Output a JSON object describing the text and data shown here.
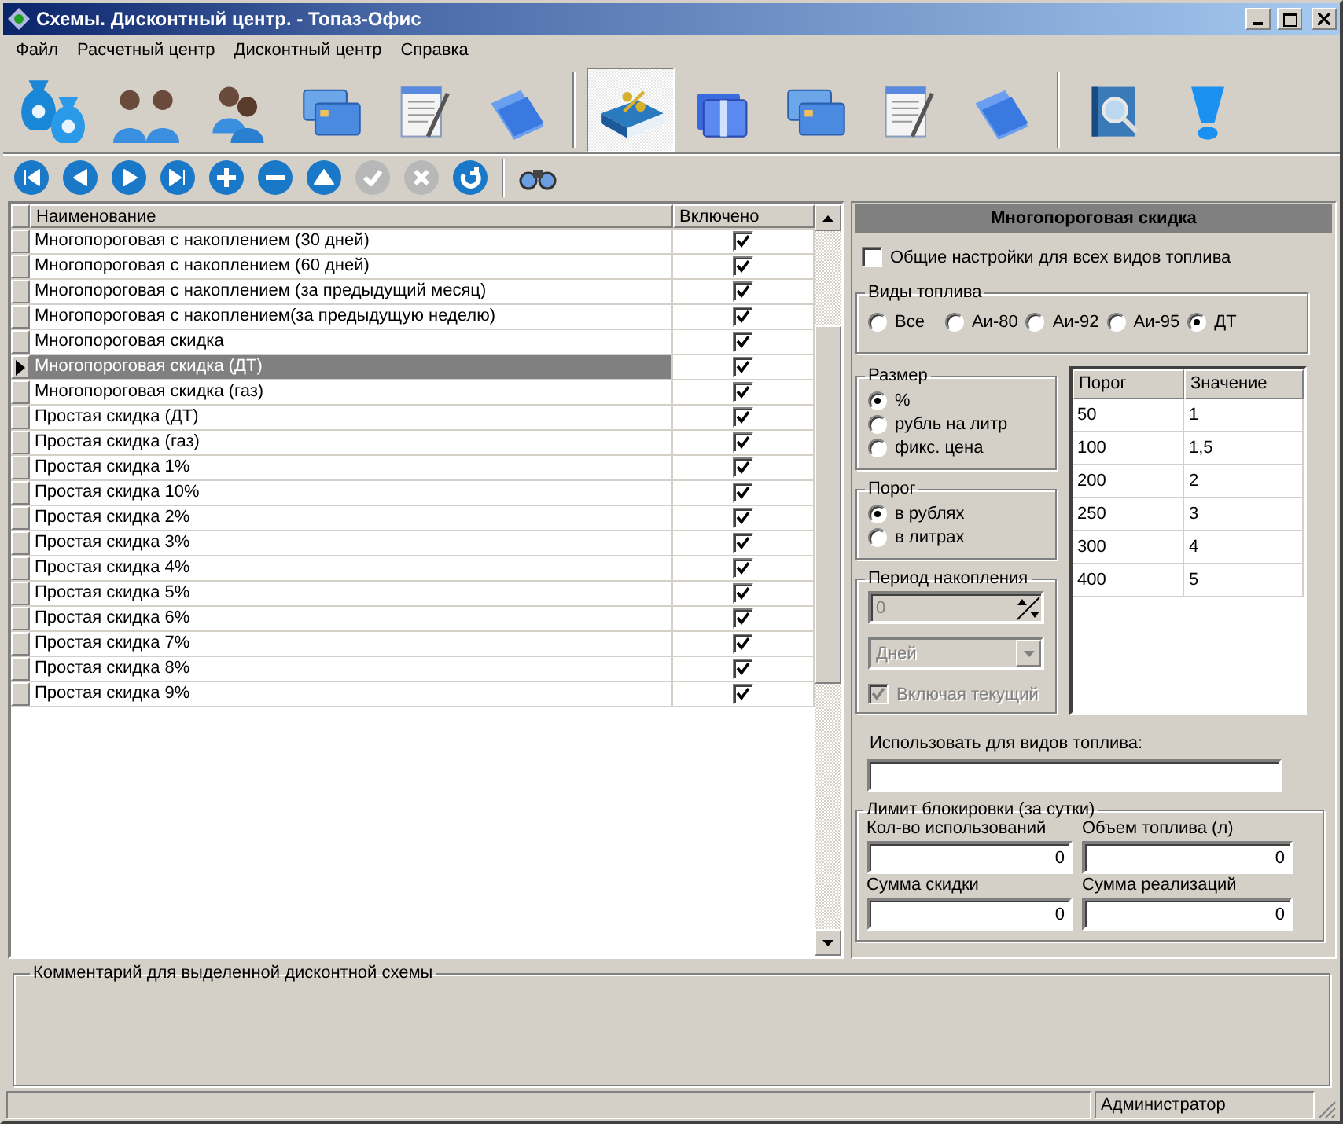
{
  "window": {
    "title": "Схемы. Дисконтный центр. - Топаз-Офис"
  },
  "menu": [
    "Файл",
    "Расчетный центр",
    "Дисконтный центр",
    "Справка"
  ],
  "toolbar": [
    {
      "kind": "bags",
      "selected": false
    },
    {
      "kind": "people",
      "selected": false
    },
    {
      "kind": "pair",
      "selected": false
    },
    {
      "kind": "cards",
      "selected": false
    },
    {
      "kind": "notepad",
      "selected": false
    },
    {
      "kind": "folder",
      "selected": false
    },
    {
      "kind": "separator"
    },
    {
      "kind": "book",
      "selected": true
    },
    {
      "kind": "stack",
      "selected": false
    },
    {
      "kind": "cards",
      "selected": false
    },
    {
      "kind": "notepad",
      "selected": false
    },
    {
      "kind": "folder",
      "selected": false
    },
    {
      "kind": "separator"
    },
    {
      "kind": "search",
      "selected": false
    },
    {
      "kind": "alert",
      "selected": false
    }
  ],
  "navigator": [
    {
      "kind": "first",
      "disabled": false
    },
    {
      "kind": "prev",
      "disabled": false
    },
    {
      "kind": "next",
      "disabled": false
    },
    {
      "kind": "last",
      "disabled": false
    },
    {
      "kind": "add",
      "disabled": false
    },
    {
      "kind": "remove",
      "disabled": false
    },
    {
      "kind": "up",
      "disabled": false
    },
    {
      "kind": "post",
      "disabled": true
    },
    {
      "kind": "cancel",
      "disabled": true
    },
    {
      "kind": "refresh",
      "disabled": false
    },
    {
      "kind": "separator"
    },
    {
      "kind": "find",
      "disabled": false
    }
  ],
  "grid": {
    "columns": [
      "Наименование",
      "Включено"
    ],
    "rows": [
      {
        "name": "Многопороговая с накоплением (30 дней)",
        "enabled": true,
        "selected": false
      },
      {
        "name": "Многопороговая с накоплением (60 дней)",
        "enabled": true,
        "selected": false
      },
      {
        "name": "Многопороговая с накоплением (за предыдущий месяц)",
        "enabled": true,
        "selected": false
      },
      {
        "name": "Многопороговая с накоплением(за предыдущую неделю)",
        "enabled": true,
        "selected": false
      },
      {
        "name": "Многопороговая скидка",
        "enabled": true,
        "selected": false
      },
      {
        "name": "Многопороговая скидка (ДТ)",
        "enabled": true,
        "selected": true
      },
      {
        "name": "Многопороговая скидка (газ)",
        "enabled": true,
        "selected": false
      },
      {
        "name": "Простая скидка (ДТ)",
        "enabled": true,
        "selected": false
      },
      {
        "name": "Простая скидка (газ)",
        "enabled": true,
        "selected": false
      },
      {
        "name": "Простая скидка 1%",
        "enabled": true,
        "selected": false
      },
      {
        "name": "Простая скидка 10%",
        "enabled": true,
        "selected": false
      },
      {
        "name": "Простая скидка 2%",
        "enabled": true,
        "selected": false
      },
      {
        "name": "Простая скидка 3%",
        "enabled": true,
        "selected": false
      },
      {
        "name": "Простая скидка 4%",
        "enabled": true,
        "selected": false
      },
      {
        "name": "Простая скидка 5%",
        "enabled": true,
        "selected": false
      },
      {
        "name": "Простая скидка 6%",
        "enabled": true,
        "selected": false
      },
      {
        "name": "Простая скидка 7%",
        "enabled": true,
        "selected": false
      },
      {
        "name": "Простая скидка 8%",
        "enabled": true,
        "selected": false
      },
      {
        "name": "Простая скидка 9%",
        "enabled": true,
        "selected": false
      }
    ]
  },
  "panel": {
    "title": "Многопороговая скидка",
    "common": {
      "label": "Общие настройки для всех видов топлива",
      "checked": false
    },
    "fuel": {
      "label": "Виды топлива",
      "options": [
        {
          "label": "Все",
          "selected": false
        },
        {
          "label": "Аи-80",
          "selected": false
        },
        {
          "label": "Аи-92",
          "selected": false
        },
        {
          "label": "Аи-95",
          "selected": false
        },
        {
          "label": "ДТ",
          "selected": true
        }
      ]
    },
    "size": {
      "label": "Размер",
      "options": [
        {
          "label": "%",
          "selected": true
        },
        {
          "label": "рубль на литр",
          "selected": false
        },
        {
          "label": "фикс. цена",
          "selected": false
        }
      ]
    },
    "threshold": {
      "label": "Порог",
      "options": [
        {
          "label": "в рублях",
          "selected": true
        },
        {
          "label": "в литрах",
          "selected": false
        }
      ]
    },
    "period": {
      "label": "Период накопления",
      "disabled": true,
      "value": "0",
      "unit": "Дней",
      "include": {
        "label": "Включая текущий",
        "checked": true
      }
    },
    "table": {
      "columns": [
        "Порог",
        "Значение"
      ],
      "rows": [
        [
          "50",
          "1"
        ],
        [
          "100",
          "1,5"
        ],
        [
          "200",
          "2"
        ],
        [
          "250",
          "3"
        ],
        [
          "300",
          "4"
        ],
        [
          "400",
          "5"
        ]
      ]
    },
    "fuel_use": {
      "label": "Использовать для видов топлива:"
    },
    "limit": {
      "label": "Лимит блокировки (за сутки)",
      "fields": [
        {
          "label": "Кол-во использований",
          "value": "0"
        },
        {
          "label": "Объем топлива (л)",
          "value": "0"
        },
        {
          "label": "Сумма скидки",
          "value": "0"
        },
        {
          "label": "Сумма реализаций",
          "value": "0"
        }
      ]
    }
  },
  "comment": {
    "label": "Комментарий для выделенной дисконтной схемы"
  },
  "status_bar": {
    "user": "Администратор"
  }
}
